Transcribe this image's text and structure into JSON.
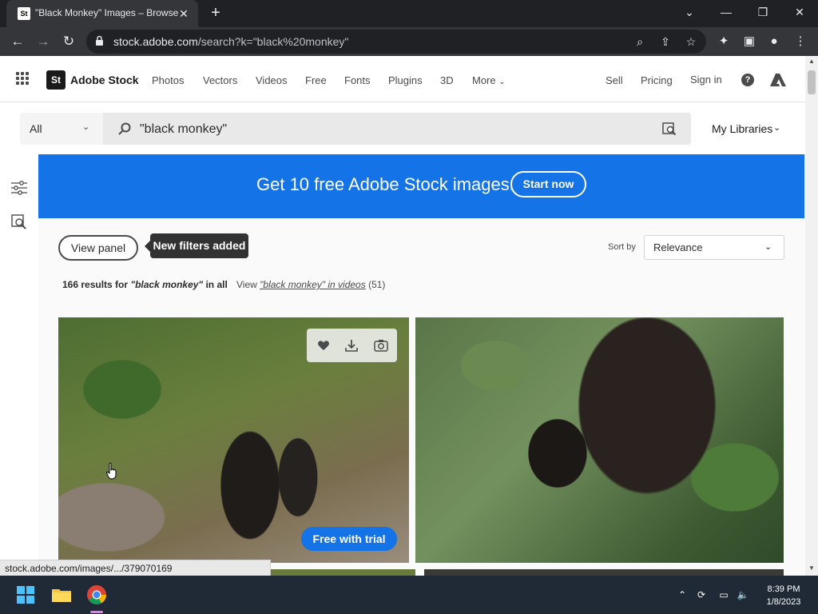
{
  "browser": {
    "tab": {
      "favicon": "St",
      "title": "\"Black Monkey\" Images – Browse"
    },
    "url": {
      "host": "stock.adobe.com",
      "path": "/search?k=\"black%20monkey\""
    }
  },
  "header": {
    "logo": "St",
    "brand": "Adobe Stock",
    "nav": [
      "Photos",
      "Vectors",
      "Videos",
      "Free",
      "Fonts",
      "Plugins",
      "3D",
      "More"
    ],
    "right": [
      "Sell",
      "Pricing",
      "Sign in"
    ],
    "help": "?"
  },
  "search": {
    "type": "All",
    "query": "\"black monkey\"",
    "my_libraries": "My Libraries"
  },
  "banner": {
    "text": "Get 10 free Adobe Stock images.",
    "button": "Start now",
    "color": "#1473e6"
  },
  "controls": {
    "view_panel": "View panel",
    "tooltip": "New filters added",
    "sort_label": "Sort by",
    "sort_value": "Relevance",
    "results_count": "166 results for ",
    "results_query": "\"black monkey\"",
    "results_suffix": " in all",
    "videos_prefix": "View ",
    "videos_link": "\"black monkey\" in videos",
    "videos_count": " (51)"
  },
  "tiles": {
    "free_trial": "Free with trial",
    "actions": [
      "heart-icon",
      "download-icon",
      "find-similar-icon"
    ]
  },
  "status_url": "stock.adobe.com/images/.../379070169",
  "taskbar": {
    "time": "8:39 PM",
    "date": "1/8/2023"
  }
}
